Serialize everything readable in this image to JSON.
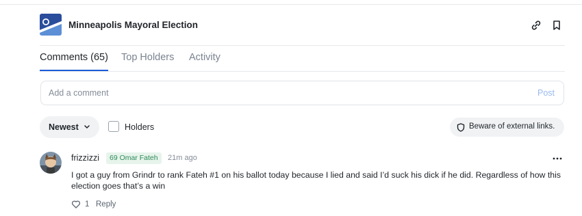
{
  "market": {
    "title": "Minneapolis Mayoral Election",
    "icons": [
      "link-icon",
      "bookmark-icon"
    ]
  },
  "tabs": [
    {
      "label": "Comments (65)",
      "active": true
    },
    {
      "label": "Top Holders",
      "active": false
    },
    {
      "label": "Activity",
      "active": false
    }
  ],
  "comment_input": {
    "placeholder": "Add a comment",
    "value": "",
    "post_label": "Post"
  },
  "filters": {
    "sort_label": "Newest",
    "holders_label": "Holders",
    "holders_checked": false,
    "warning": "Beware of external links."
  },
  "comments": [
    {
      "username": "frizzizzi",
      "badge": "69 Omar Fateh",
      "time": "21m ago",
      "text": "I got a guy from Grindr to rank Fateh #1 on his ballot today because I lied and said I’d suck his dick if he did. Regardless of how this election goes that’s a win",
      "likes": "1",
      "reply_label": "Reply"
    }
  ],
  "colors": {
    "accent": "#1a5bd8",
    "badge_bg": "#e7f4ec",
    "badge_text": "#2e8b57",
    "flag_blue": "#1f3f8f",
    "muted": "#7a8390"
  }
}
